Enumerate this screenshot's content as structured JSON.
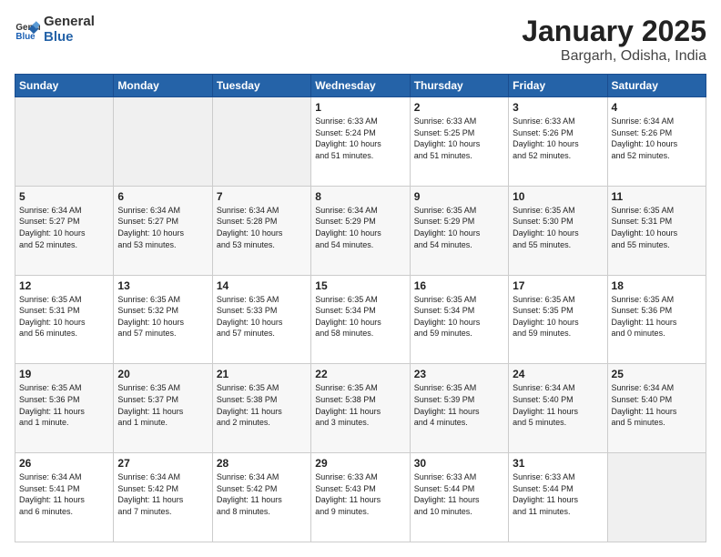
{
  "logo": {
    "line1": "General",
    "line2": "Blue"
  },
  "title": "January 2025",
  "subtitle": "Bargarh, Odisha, India",
  "weekdays": [
    "Sunday",
    "Monday",
    "Tuesday",
    "Wednesday",
    "Thursday",
    "Friday",
    "Saturday"
  ],
  "weeks": [
    [
      {
        "day": "",
        "info": ""
      },
      {
        "day": "",
        "info": ""
      },
      {
        "day": "",
        "info": ""
      },
      {
        "day": "1",
        "info": "Sunrise: 6:33 AM\nSunset: 5:24 PM\nDaylight: 10 hours\nand 51 minutes."
      },
      {
        "day": "2",
        "info": "Sunrise: 6:33 AM\nSunset: 5:25 PM\nDaylight: 10 hours\nand 51 minutes."
      },
      {
        "day": "3",
        "info": "Sunrise: 6:33 AM\nSunset: 5:26 PM\nDaylight: 10 hours\nand 52 minutes."
      },
      {
        "day": "4",
        "info": "Sunrise: 6:34 AM\nSunset: 5:26 PM\nDaylight: 10 hours\nand 52 minutes."
      }
    ],
    [
      {
        "day": "5",
        "info": "Sunrise: 6:34 AM\nSunset: 5:27 PM\nDaylight: 10 hours\nand 52 minutes."
      },
      {
        "day": "6",
        "info": "Sunrise: 6:34 AM\nSunset: 5:27 PM\nDaylight: 10 hours\nand 53 minutes."
      },
      {
        "day": "7",
        "info": "Sunrise: 6:34 AM\nSunset: 5:28 PM\nDaylight: 10 hours\nand 53 minutes."
      },
      {
        "day": "8",
        "info": "Sunrise: 6:34 AM\nSunset: 5:29 PM\nDaylight: 10 hours\nand 54 minutes."
      },
      {
        "day": "9",
        "info": "Sunrise: 6:35 AM\nSunset: 5:29 PM\nDaylight: 10 hours\nand 54 minutes."
      },
      {
        "day": "10",
        "info": "Sunrise: 6:35 AM\nSunset: 5:30 PM\nDaylight: 10 hours\nand 55 minutes."
      },
      {
        "day": "11",
        "info": "Sunrise: 6:35 AM\nSunset: 5:31 PM\nDaylight: 10 hours\nand 55 minutes."
      }
    ],
    [
      {
        "day": "12",
        "info": "Sunrise: 6:35 AM\nSunset: 5:31 PM\nDaylight: 10 hours\nand 56 minutes."
      },
      {
        "day": "13",
        "info": "Sunrise: 6:35 AM\nSunset: 5:32 PM\nDaylight: 10 hours\nand 57 minutes."
      },
      {
        "day": "14",
        "info": "Sunrise: 6:35 AM\nSunset: 5:33 PM\nDaylight: 10 hours\nand 57 minutes."
      },
      {
        "day": "15",
        "info": "Sunrise: 6:35 AM\nSunset: 5:34 PM\nDaylight: 10 hours\nand 58 minutes."
      },
      {
        "day": "16",
        "info": "Sunrise: 6:35 AM\nSunset: 5:34 PM\nDaylight: 10 hours\nand 59 minutes."
      },
      {
        "day": "17",
        "info": "Sunrise: 6:35 AM\nSunset: 5:35 PM\nDaylight: 10 hours\nand 59 minutes."
      },
      {
        "day": "18",
        "info": "Sunrise: 6:35 AM\nSunset: 5:36 PM\nDaylight: 11 hours\nand 0 minutes."
      }
    ],
    [
      {
        "day": "19",
        "info": "Sunrise: 6:35 AM\nSunset: 5:36 PM\nDaylight: 11 hours\nand 1 minute."
      },
      {
        "day": "20",
        "info": "Sunrise: 6:35 AM\nSunset: 5:37 PM\nDaylight: 11 hours\nand 1 minute."
      },
      {
        "day": "21",
        "info": "Sunrise: 6:35 AM\nSunset: 5:38 PM\nDaylight: 11 hours\nand 2 minutes."
      },
      {
        "day": "22",
        "info": "Sunrise: 6:35 AM\nSunset: 5:38 PM\nDaylight: 11 hours\nand 3 minutes."
      },
      {
        "day": "23",
        "info": "Sunrise: 6:35 AM\nSunset: 5:39 PM\nDaylight: 11 hours\nand 4 minutes."
      },
      {
        "day": "24",
        "info": "Sunrise: 6:34 AM\nSunset: 5:40 PM\nDaylight: 11 hours\nand 5 minutes."
      },
      {
        "day": "25",
        "info": "Sunrise: 6:34 AM\nSunset: 5:40 PM\nDaylight: 11 hours\nand 5 minutes."
      }
    ],
    [
      {
        "day": "26",
        "info": "Sunrise: 6:34 AM\nSunset: 5:41 PM\nDaylight: 11 hours\nand 6 minutes."
      },
      {
        "day": "27",
        "info": "Sunrise: 6:34 AM\nSunset: 5:42 PM\nDaylight: 11 hours\nand 7 minutes."
      },
      {
        "day": "28",
        "info": "Sunrise: 6:34 AM\nSunset: 5:42 PM\nDaylight: 11 hours\nand 8 minutes."
      },
      {
        "day": "29",
        "info": "Sunrise: 6:33 AM\nSunset: 5:43 PM\nDaylight: 11 hours\nand 9 minutes."
      },
      {
        "day": "30",
        "info": "Sunrise: 6:33 AM\nSunset: 5:44 PM\nDaylight: 11 hours\nand 10 minutes."
      },
      {
        "day": "31",
        "info": "Sunrise: 6:33 AM\nSunset: 5:44 PM\nDaylight: 11 hours\nand 11 minutes."
      },
      {
        "day": "",
        "info": ""
      }
    ]
  ]
}
